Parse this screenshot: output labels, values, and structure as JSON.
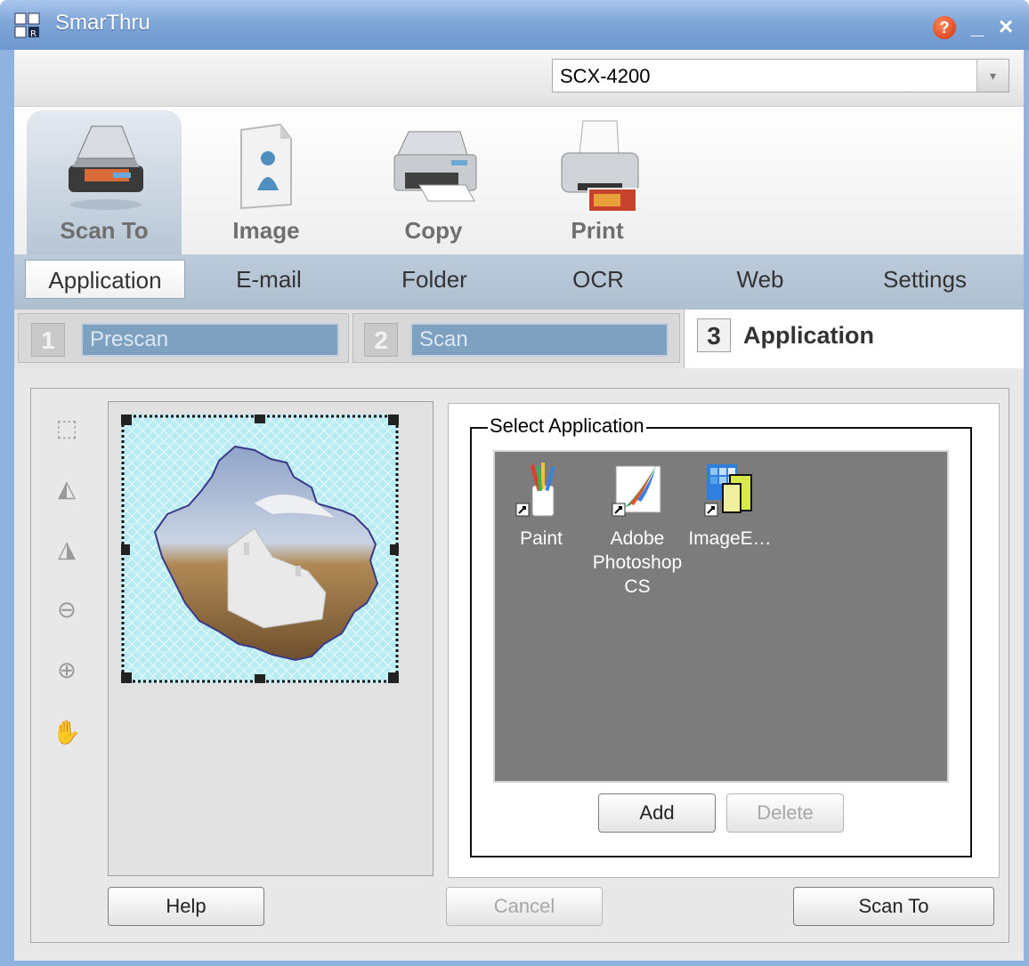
{
  "window": {
    "title": "SmarThru",
    "help_glyph": "?",
    "minimize_glyph": "_",
    "close_glyph": "×"
  },
  "device": {
    "selected": "SCX-4200",
    "dropdown_glyph": "▾"
  },
  "modes": [
    {
      "label": "Scan To",
      "icon": "scanner-icon",
      "active": true
    },
    {
      "label": "Image",
      "icon": "image-document-icon",
      "active": false
    },
    {
      "label": "Copy",
      "icon": "copier-icon",
      "active": false
    },
    {
      "label": "Print",
      "icon": "printer-icon",
      "active": false
    }
  ],
  "sub_tabs": [
    {
      "label": "Application",
      "active": true
    },
    {
      "label": "E-mail",
      "active": false
    },
    {
      "label": "Folder",
      "active": false
    },
    {
      "label": "OCR",
      "active": false
    },
    {
      "label": "Web",
      "active": false
    },
    {
      "label": "Settings",
      "active": false
    }
  ],
  "steps": [
    {
      "num": "1",
      "label": "Prescan",
      "active": false
    },
    {
      "num": "2",
      "label": "Scan",
      "active": false
    },
    {
      "num": "3",
      "label": "Application",
      "active": true
    }
  ],
  "tools": [
    {
      "icon": "selection-marquee-icon",
      "glyph": "⬚"
    },
    {
      "icon": "flip-horizontal-icon",
      "glyph": "◭"
    },
    {
      "icon": "mirror-icon",
      "glyph": "◮"
    },
    {
      "icon": "zoom-out-icon",
      "glyph": "⊖"
    },
    {
      "icon": "zoom-in-icon",
      "glyph": "⊕"
    },
    {
      "icon": "hand-pan-icon",
      "glyph": "✋"
    }
  ],
  "select_application": {
    "label": "Select Application",
    "apps": [
      {
        "label": "Paint",
        "icon": "paint-brushes-icon"
      },
      {
        "label": "Adobe Photoshop CS",
        "icon": "photoshop-feather-icon"
      },
      {
        "label": "ImageE…",
        "icon": "image-editor-icon"
      }
    ],
    "add_label": "Add",
    "delete_label": "Delete"
  },
  "footer": {
    "help_label": "Help",
    "cancel_label": "Cancel",
    "scan_to_label": "Scan To"
  }
}
